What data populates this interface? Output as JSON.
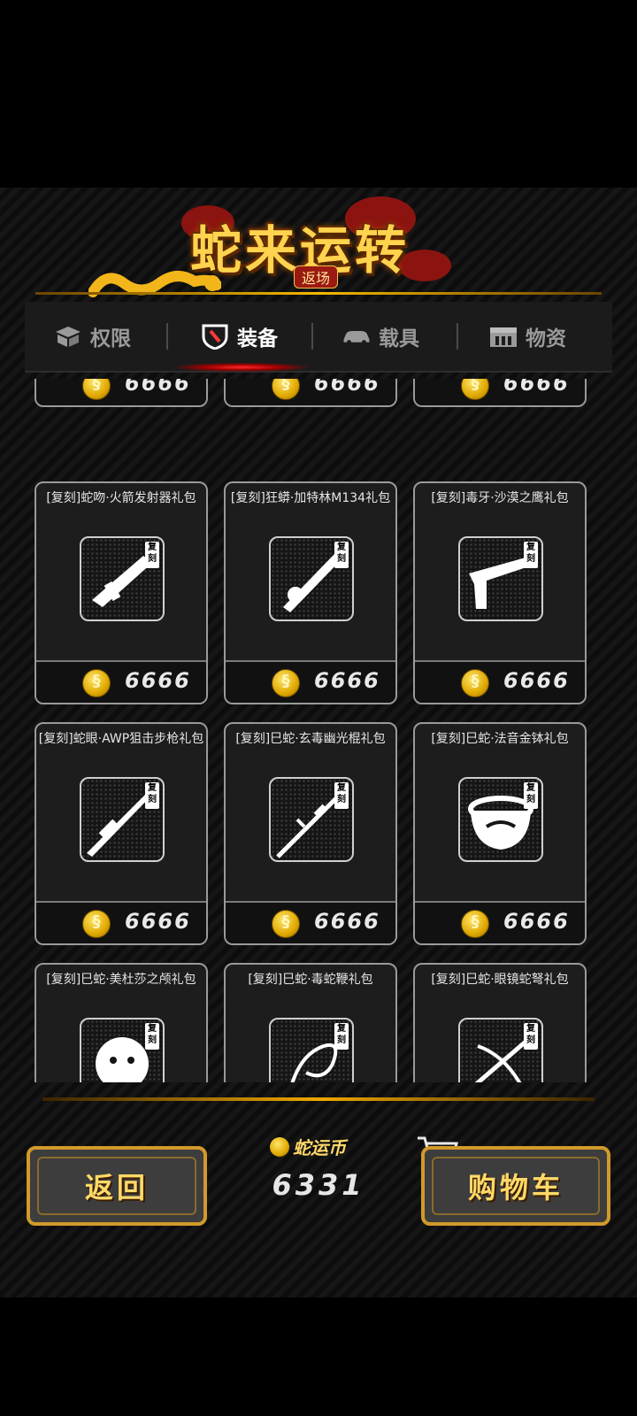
{
  "header": {
    "title": "蛇来运转",
    "subtitle": "返场"
  },
  "tabs": [
    {
      "label": "权限",
      "icon": "box-icon",
      "active": false
    },
    {
      "label": "装备",
      "icon": "weapon-shield-icon",
      "active": true
    },
    {
      "label": "载具",
      "icon": "car-icon",
      "active": false
    },
    {
      "label": "物资",
      "icon": "crate-icon",
      "active": false
    }
  ],
  "items": [
    {
      "title": "",
      "price": "6666",
      "icon": "weapon-icon"
    },
    {
      "title": "",
      "price": "6666",
      "icon": "weapon-icon"
    },
    {
      "title": "",
      "price": "6666",
      "icon": "weapon-icon"
    },
    {
      "title": "[复刻]蛇吻·火箭发射器礼包",
      "price": "6666",
      "tag": "复刻",
      "icon": "rocket-launcher-icon"
    },
    {
      "title": "[复刻]狂蟒·加特林M134礼包",
      "price": "6666",
      "tag": "复刻",
      "icon": "gatling-gun-icon"
    },
    {
      "title": "[复刻]毒牙·沙漠之鹰礼包",
      "price": "6666",
      "tag": "复刻",
      "icon": "pistol-icon"
    },
    {
      "title": "[复刻]蛇眼·AWP狙击步枪礼包",
      "price": "6666",
      "tag": "复刻",
      "icon": "sniper-rifle-icon"
    },
    {
      "title": "[复刻]巳蛇·玄毒幽光棍礼包",
      "price": "6666",
      "tag": "复刻",
      "icon": "staff-icon"
    },
    {
      "title": "[复刻]巳蛇·法音金钵礼包",
      "price": "6666",
      "tag": "复刻",
      "icon": "bowl-icon"
    },
    {
      "title": "[复刻]巳蛇·美杜莎之颅礼包",
      "price": "",
      "tag": "复刻",
      "icon": "medusa-head-icon"
    },
    {
      "title": "[复刻]巳蛇·毒蛇鞭礼包",
      "price": "",
      "tag": "复刻",
      "icon": "whip-icon"
    },
    {
      "title": "[复刻]巳蛇·眼镜蛇弩礼包",
      "price": "",
      "tag": "复刻",
      "icon": "crossbow-icon"
    }
  ],
  "footer": {
    "back_label": "返回",
    "currency_label": "蛇运币",
    "currency_value": "6331",
    "cart_label": "购物车"
  }
}
